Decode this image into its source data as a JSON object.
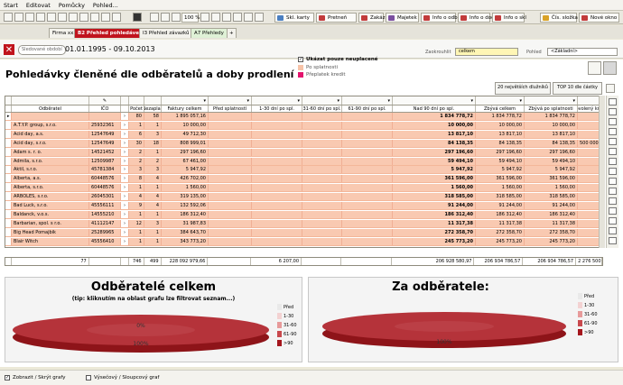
{
  "menu": [
    "Start",
    "Editovat",
    "Pomůcky",
    "Pohled..."
  ],
  "toolbar": {
    "zoom": "100 %",
    "buttons": [
      {
        "label": "Skl. karty",
        "color": "#4a7fc1"
      },
      {
        "label": "Pretneň",
        "color": "#c23b3b"
      },
      {
        "label": "Zakázky",
        "color": "#c23b3b"
      },
      {
        "label": "Majetek",
        "color": "#7b4fa0"
      },
      {
        "label": "Info o odb",
        "color": "#c23b3b"
      },
      {
        "label": "Info o dod",
        "color": "#c23b3b"
      },
      {
        "label": "Info o skl",
        "color": "#c23b3b"
      },
      {
        "label": "Čís. složka",
        "color": "#d9a227"
      },
      {
        "label": "Nové okno",
        "color": "#c23b3b"
      }
    ]
  },
  "tabs": [
    "Firma xxx",
    "B2 Přehled pohledávek",
    "I3 Přehled závazků",
    "A7 Přehledy"
  ],
  "filter": {
    "label": "Sledované období",
    "from": "01.01.1995",
    "to": "09.10.2013"
  },
  "page_title": "Pohledávky členěné dle odběratelů a doby prodlení",
  "options": {
    "only_overdue": "Ukázat pouze neuplacené",
    "after_due_label": "Po splatnosti",
    "overpaid_label": "Přeplatek kredit"
  },
  "group": {
    "label": "Zaokrouhlit",
    "value": "celkem"
  },
  "view": {
    "label": "Pohled",
    "value": "<Základní>"
  },
  "btn_top20": "20 největších dlužníků",
  "btn_top10": "TOP 10 dle částky",
  "columns": [
    "",
    "Odběratel",
    "IČO",
    "",
    "Počet",
    "Nezaplac",
    "Faktury celkem",
    "Před splatností",
    "1-30 dní po spl.",
    "31-60 dní po spl.",
    "61-90 dní po spl.",
    "Nad 90 dní po spl.",
    "Zbývá celkem",
    "Zbývá po splatnosti",
    "Povolený kredit"
  ],
  "rows": [
    [
      "",
      "",
      "",
      "",
      "80",
      "58",
      "1 895 057,16",
      "",
      "",
      "",
      "",
      "1 834 778,72",
      "1 834 778,72",
      "1 834 778,72",
      ""
    ],
    [
      "",
      "A.T.Y.P. group, s.r.o.",
      "25932361",
      "",
      "1",
      "1",
      "10 000,00",
      "",
      "",
      "",
      "",
      "10 000,00",
      "10 000,00",
      "10 000,00",
      ""
    ],
    [
      "",
      "Acid day, a.s.",
      "12547649",
      "",
      "6",
      "3",
      "49 712,30",
      "",
      "",
      "",
      "",
      "13 817,10",
      "13 817,10",
      "13 817,10",
      ""
    ],
    [
      "",
      "Acid day, s.r.o.",
      "12547649",
      "",
      "30",
      "18",
      "808 999,01",
      "",
      "",
      "",
      "",
      "84 138,35",
      "84 138,35",
      "84 138,35",
      "500 000,00"
    ],
    [
      "",
      "Adam s. r. o.",
      "14521452",
      "",
      "2",
      "1",
      "297 196,60",
      "",
      "",
      "",
      "",
      "297 196,60",
      "297 196,60",
      "297 196,60",
      ""
    ],
    [
      "",
      "Admila, s.r.o.",
      "12509987",
      "",
      "2",
      "2",
      "67 461,00",
      "",
      "",
      "",
      "",
      "59 494,10",
      "59 494,10",
      "59 494,10",
      ""
    ],
    [
      "",
      "Aktil, s.r.o.",
      "45781384",
      "",
      "3",
      "3",
      "5 947,92",
      "",
      "",
      "",
      "",
      "5 947,92",
      "5 947,92",
      "5 947,92",
      ""
    ],
    [
      "",
      "Alberta, a.s.",
      "60448576",
      "",
      "8",
      "4",
      "426 702,00",
      "",
      "",
      "",
      "",
      "361 596,00",
      "361 596,00",
      "361 596,00",
      ""
    ],
    [
      "",
      "Alberta, s.r.o.",
      "60448576",
      "",
      "1",
      "1",
      "1 560,00",
      "",
      "",
      "",
      "",
      "1 560,00",
      "1 560,00",
      "1 560,00",
      ""
    ],
    [
      "",
      "ARBOLES, s.r.o.",
      "26045301",
      "",
      "4",
      "4",
      "319 135,00",
      "",
      "",
      "",
      "",
      "318 585,00",
      "318 585,00",
      "318 585,00",
      ""
    ],
    [
      "",
      "Bad Luck, s.r.o.",
      "45556111",
      "",
      "9",
      "4",
      "132 592,06",
      "",
      "",
      "",
      "",
      "91 244,00",
      "91 244,00",
      "91 244,00",
      ""
    ],
    [
      "",
      "Baldanck, v.o.s.",
      "14555210",
      "",
      "1",
      "1",
      "186 312,40",
      "",
      "",
      "",
      "",
      "186 312,40",
      "186 312,40",
      "186 312,40",
      ""
    ],
    [
      "",
      "Barbarian, spol. s r.o.",
      "41112147",
      "",
      "12",
      "3",
      "31 987,83",
      "",
      "",
      "",
      "",
      "11 317,38",
      "11 317,38",
      "11 317,38",
      ""
    ],
    [
      "",
      "Big Head Pomajbik",
      "25289965",
      "",
      "1",
      "1",
      "384 643,70",
      "",
      "",
      "",
      "",
      "272 358,70",
      "272 358,70",
      "272 358,70",
      ""
    ],
    [
      "",
      "Blair Witch",
      "45556410",
      "",
      "1",
      "1",
      "343 773,20",
      "",
      "",
      "",
      "",
      "245 773,20",
      "245 773,20",
      "245 773,20",
      ""
    ]
  ],
  "totals": [
    "",
    "77",
    "",
    "",
    "746",
    "499",
    "228 092 979,66",
    "",
    "6 207,00",
    "",
    "",
    "206 928 580,97",
    "206 934 786,57",
    "206 934 786,57",
    "2 276 500,00"
  ],
  "chart1": {
    "title": "Odběratelé celkem",
    "subtitle": "(tip: kliknutím na oblast grafu lze filtrovat seznam...)",
    "label_top": "0%",
    "label_bottom": "100%"
  },
  "chart2": {
    "title": "Za odběratele:",
    "label_bottom": "100%"
  },
  "chart_legend": [
    {
      "label": "Před",
      "color": "#e9e9e9"
    },
    {
      "label": "1-30",
      "color": "#f3d2d2"
    },
    {
      "label": "31-60",
      "color": "#e79a9a"
    },
    {
      "label": "61-90",
      "color": "#c9494d"
    },
    {
      "label": ">90",
      "color": "#a5161d"
    }
  ],
  "chart_data": [
    {
      "type": "pie",
      "title": "Odběratelé celkem",
      "categories": [
        "Před",
        "1-30",
        "31-60",
        "61-90",
        ">90"
      ],
      "values": [
        0,
        0,
        0,
        0,
        100
      ]
    },
    {
      "type": "pie",
      "title": "Za odběratele:",
      "categories": [
        "Před",
        "1-30",
        "31-60",
        "61-90",
        ">90"
      ],
      "values": [
        0,
        0,
        0,
        0,
        100
      ]
    }
  ],
  "bottom": {
    "show_charts": "Zobrazit / Skrýt grafy",
    "chart_type": "Výsečový / Sloupcový graf"
  }
}
